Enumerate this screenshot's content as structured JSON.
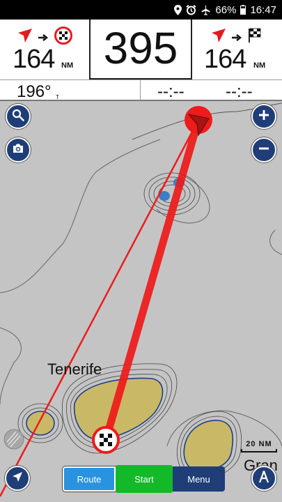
{
  "status_bar": {
    "battery": "66%",
    "time": "16:47"
  },
  "dashboard": {
    "left": {
      "value": "164",
      "unit": "NM"
    },
    "center": {
      "value": "395"
    },
    "right": {
      "value": "164",
      "unit": "NM"
    },
    "bearing": {
      "value": "196°",
      "unit": "T"
    },
    "time_to_waypoint": "--:--",
    "time_to_destination": "--:--"
  },
  "map": {
    "place_labels": [
      "Tenerife",
      "Gran"
    ],
    "scale": "20 NM"
  },
  "toolbar": {
    "route_label": "Route",
    "start_label": "Start",
    "menu_label": "Menu"
  },
  "colors": {
    "accent_blue": "#1f3e78",
    "route_blue": "#2a93e0",
    "start_green": "#14b92a",
    "route_red": "#ef1a1a",
    "land": "#c9b966",
    "sea": "#c4c4c4"
  }
}
